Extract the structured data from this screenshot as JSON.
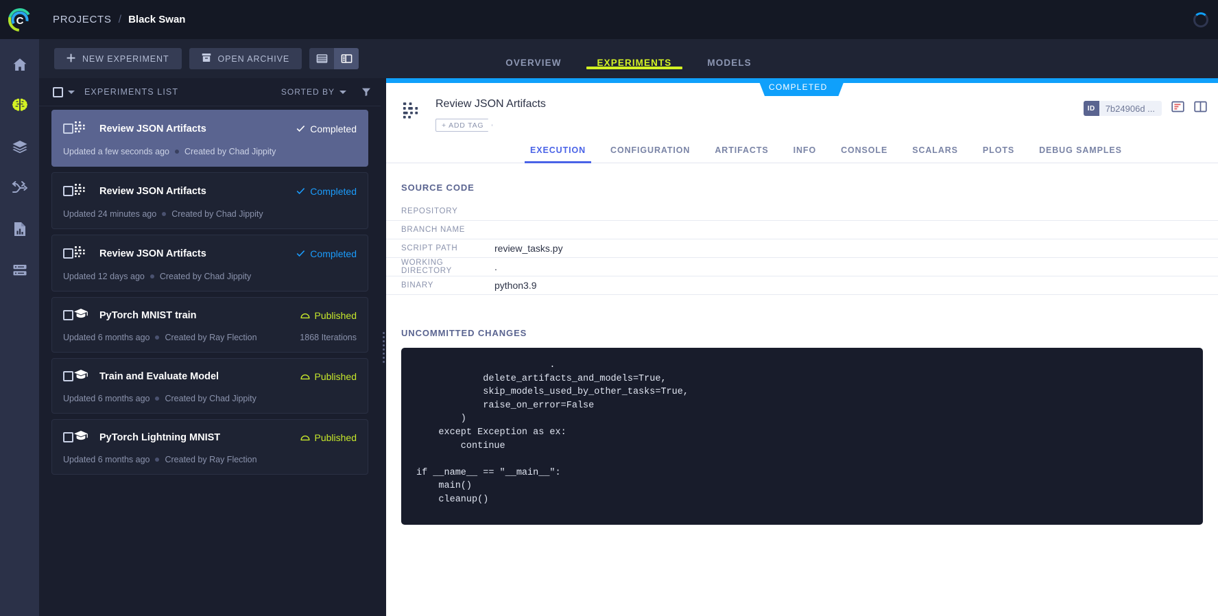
{
  "topbar": {
    "logo_icon": "clearml-logo-icon",
    "breadcrumb_root": "PROJECTS",
    "breadcrumb_separator": "/",
    "breadcrumb_current": "Black Swan"
  },
  "sidebar": {
    "items": [
      {
        "label": "Home",
        "icon": "home-icon",
        "active": false
      },
      {
        "label": "Pipelines",
        "icon": "brain-icon",
        "active": true
      },
      {
        "label": "Datasets",
        "icon": "layers-icon",
        "active": false
      },
      {
        "label": "Workflows",
        "icon": "shuffle-arrows-icon",
        "active": false
      },
      {
        "label": "Reports",
        "icon": "file-chart-icon",
        "active": false
      },
      {
        "label": "Workers",
        "icon": "server-rack-icon",
        "active": false
      }
    ]
  },
  "actionbar": {
    "new_experiment": "NEW EXPERIMENT",
    "new_experiment_icon": "plus-icon",
    "open_archive": "OPEN ARCHIVE",
    "open_archive_icon": "archive-box-icon",
    "view_table_icon": "table-view-icon",
    "view_split_icon": "split-view-icon",
    "active_view": "split"
  },
  "top_tabs": [
    {
      "label": "OVERVIEW",
      "active": false
    },
    {
      "label": "EXPERIMENTS",
      "active": true
    },
    {
      "label": "MODELS",
      "active": false
    }
  ],
  "list_header": {
    "title": "EXPERIMENTS LIST",
    "sorted_by": "SORTED BY",
    "filter_icon": "funnel-filter-icon",
    "select_all_checked": false
  },
  "experiments": [
    {
      "name": "Review JSON Artifacts",
      "icon": "task-dots-icon",
      "status": "Completed",
      "status_kind": "completed",
      "status_icon": "check-icon",
      "updated": "Updated a few seconds ago",
      "created_by": "Created by Chad Jippity",
      "iterations": "",
      "selected": true
    },
    {
      "name": "Review JSON Artifacts",
      "icon": "task-dots-icon",
      "status": "Completed",
      "status_kind": "completed",
      "status_icon": "check-icon",
      "updated": "Updated 24 minutes ago",
      "created_by": "Created by Chad Jippity",
      "iterations": "",
      "selected": false
    },
    {
      "name": "Review JSON Artifacts",
      "icon": "task-dots-icon",
      "status": "Completed",
      "status_kind": "completed",
      "status_icon": "check-icon",
      "updated": "Updated 12 days ago",
      "created_by": "Created by Chad Jippity",
      "iterations": "",
      "selected": false
    },
    {
      "name": "PyTorch MNIST train",
      "icon": "graduation-cap-icon",
      "status": "Published",
      "status_kind": "published",
      "status_icon": "cloud-icon",
      "updated": "Updated 6 months ago",
      "created_by": "Created by Ray Flection",
      "iterations": "1868 Iterations",
      "selected": false
    },
    {
      "name": "Train and Evaluate Model",
      "icon": "graduation-cap-icon",
      "status": "Published",
      "status_kind": "published",
      "status_icon": "cloud-icon",
      "updated": "Updated 6 months ago",
      "created_by": "Created by Chad Jippity",
      "iterations": "",
      "selected": false
    },
    {
      "name": "PyTorch Lightning MNIST",
      "icon": "graduation-cap-icon",
      "status": "Published",
      "status_kind": "published",
      "status_icon": "cloud-icon",
      "updated": "Updated 6 months ago",
      "created_by": "Created by Ray Flection",
      "iterations": "",
      "selected": false
    }
  ],
  "detail": {
    "status_badge": "COMPLETED",
    "status_color": "#0fa0fb",
    "icon": "task-dots-icon",
    "title": "Review JSON Artifacts",
    "add_tag_label": "+ ADD TAG",
    "id_label": "ID",
    "id_value": "7b24906d ...",
    "header_icons": [
      {
        "name": "details-panel-icon"
      },
      {
        "name": "compare-panel-icon"
      }
    ],
    "tabs": [
      {
        "label": "EXECUTION",
        "active": true
      },
      {
        "label": "CONFIGURATION",
        "active": false
      },
      {
        "label": "ARTIFACTS",
        "active": false
      },
      {
        "label": "INFO",
        "active": false
      },
      {
        "label": "CONSOLE",
        "active": false
      },
      {
        "label": "SCALARS",
        "active": false
      },
      {
        "label": "PLOTS",
        "active": false
      },
      {
        "label": "DEBUG SAMPLES",
        "active": false
      }
    ],
    "source_code": {
      "section_title": "SOURCE CODE",
      "rows": [
        {
          "key": "REPOSITORY",
          "value": ""
        },
        {
          "key": "BRANCH NAME",
          "value": ""
        },
        {
          "key": "SCRIPT PATH",
          "value": "review_tasks.py"
        },
        {
          "key": "WORKING DIRECTORY",
          "value": "."
        },
        {
          "key": "BINARY",
          "value": "python3.9"
        }
      ]
    },
    "uncommitted": {
      "section_title": "UNCOMMITTED CHANGES",
      "code_lines": [
        "                        .",
        "            delete_artifacts_and_models=True,",
        "            skip_models_used_by_other_tasks=True,",
        "            raise_on_error=False",
        "        )",
        "    except Exception as ex:",
        "        continue",
        "",
        "if __name__ == \"__main__\":",
        "    main()",
        "    cleanup()"
      ]
    }
  },
  "colors": {
    "accent_lime": "#d3f223",
    "accent_blue": "#1b9cfc",
    "tab_blue": "#4a63e7",
    "status_blue": "#0fa0fb",
    "panel_dark": "#1a1e2d",
    "rail_dark": "#2b3148",
    "selected_row": "#5a6490"
  }
}
